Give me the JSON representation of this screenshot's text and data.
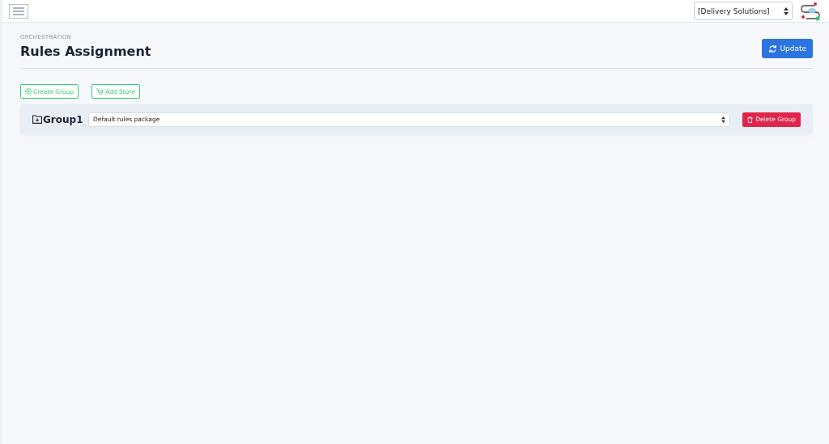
{
  "topbar": {
    "org_select": {
      "value": "[Delivery Solutions]"
    }
  },
  "header": {
    "overline": "ORCHESTRATION",
    "title": "Rules Assignment",
    "update_button": "Update"
  },
  "actions": [
    "Create Group",
    "Add Store"
  ],
  "groups": [
    {
      "name": "Group1",
      "rules_select": {
        "value": "Default rules package"
      },
      "delete_button": "Delete Group"
    }
  ]
}
